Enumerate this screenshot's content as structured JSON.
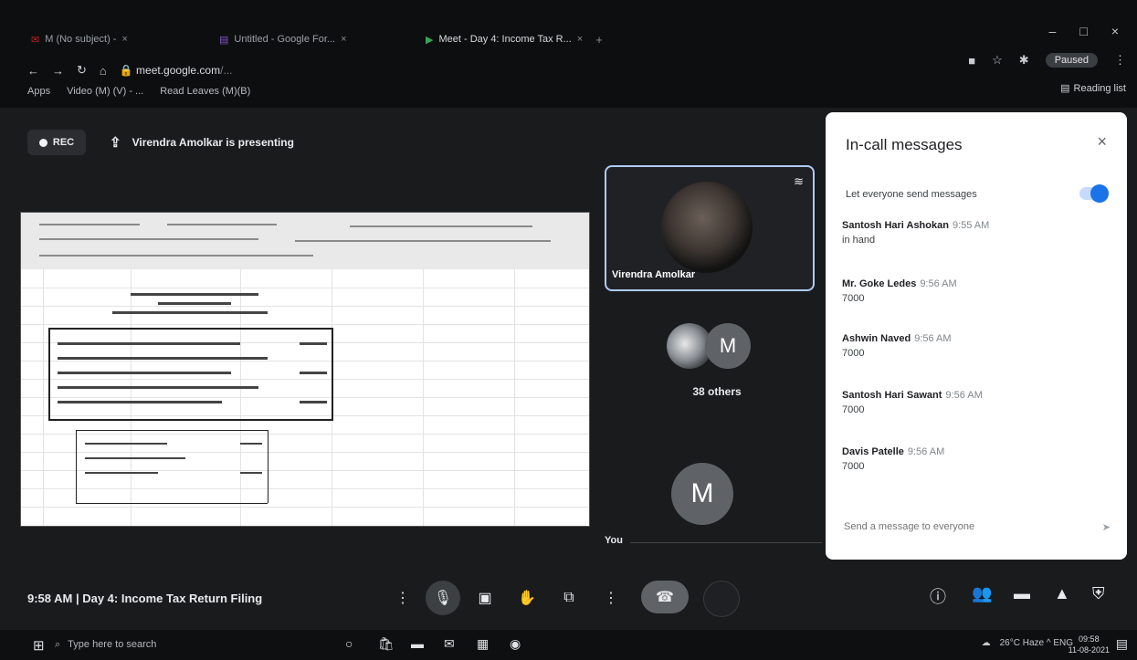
{
  "browser": {
    "tabs": [
      {
        "label": "M (No subject) - ",
        "close": "×"
      },
      {
        "label": "Untitled - Google For...",
        "close": "×"
      },
      {
        "label": "Meet - Day 4: Income Tax R...",
        "close": "×"
      }
    ],
    "new_tab": "+",
    "url_host": "meet.google.com",
    "url_rest": "/...",
    "bookmarks": [
      "Apps",
      "Video (M) (V) - ...",
      "Read Leaves (M)(B)"
    ],
    "profile_label": "Paused",
    "reading_list": "Reading list",
    "window_controls": [
      "–",
      "□",
      "×"
    ]
  },
  "meet": {
    "rec_label": "REC",
    "presenting": "Virendra Amolkar is presenting",
    "main_tile_name": "Virendra Amolkar",
    "others_label": "38 others",
    "you_initial": "M",
    "others_initial": "M",
    "you_label": "You",
    "meeting_info": "9:58 AM | Day 4: Income Tax Return Filing"
  },
  "chat": {
    "title": "In-call messages",
    "close": "×",
    "toggle_label": "Let everyone send messages",
    "messages": [
      {
        "who": "Santosh Hari Ashokan",
        "time": "9:55 AM",
        "text": "in hand"
      },
      {
        "who": "Mr. Goke Ledes",
        "time": "9:56 AM",
        "text": "7000"
      },
      {
        "who": "Ashwin Naved",
        "time": "9:56 AM",
        "text": "7000"
      },
      {
        "who": "Santosh Hari Sawant",
        "time": "9:56 AM",
        "text": "7000"
      },
      {
        "who": "Davis Patelle",
        "time": "9:56 AM",
        "text": "7000"
      }
    ],
    "input_placeholder": "Send a message to everyone",
    "send_icon": "➤"
  },
  "taskbar": {
    "search_placeholder": "Type here to search",
    "tray_text": "26°C Haze   ^  ENG",
    "time": "09:58",
    "date": "11-08-2021"
  }
}
